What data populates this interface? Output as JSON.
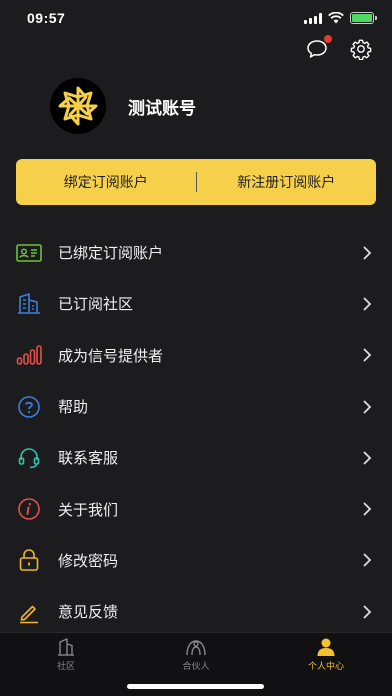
{
  "status_bar": {
    "time": "09:57"
  },
  "profile": {
    "username": "测试账号"
  },
  "subscription": {
    "bind_label": "绑定订阅账户",
    "register_label": "新注册订阅账户"
  },
  "menu": {
    "items": [
      {
        "label": "已绑定订阅账户",
        "icon": "id-card-icon",
        "color": "#6fbf3a"
      },
      {
        "label": "已订阅社区",
        "icon": "building-icon",
        "color": "#3d7fe0"
      },
      {
        "label": "成为信号提供者",
        "icon": "signal-bars-icon",
        "color": "#e2504a"
      },
      {
        "label": "帮助",
        "icon": "question-icon",
        "color": "#3d7fe0"
      },
      {
        "label": "联系客服",
        "icon": "headset-icon",
        "color": "#2fc1b0"
      },
      {
        "label": "关于我们",
        "icon": "info-icon",
        "color": "#e2504a"
      },
      {
        "label": "修改密码",
        "icon": "lock-icon",
        "color": "#f0b429"
      },
      {
        "label": "意见反馈",
        "icon": "pencil-icon",
        "color": "#f0b429"
      }
    ]
  },
  "tabbar": {
    "tabs": [
      {
        "label": "社区",
        "icon": "community-icon",
        "active": false
      },
      {
        "label": "合伙人",
        "icon": "partner-icon",
        "active": false
      },
      {
        "label": "个人中心",
        "icon": "person-icon",
        "active": true
      }
    ]
  },
  "colors": {
    "accent": "#f6cf4b",
    "background": "#1c1c1e",
    "active_tab": "#f4c02f"
  }
}
